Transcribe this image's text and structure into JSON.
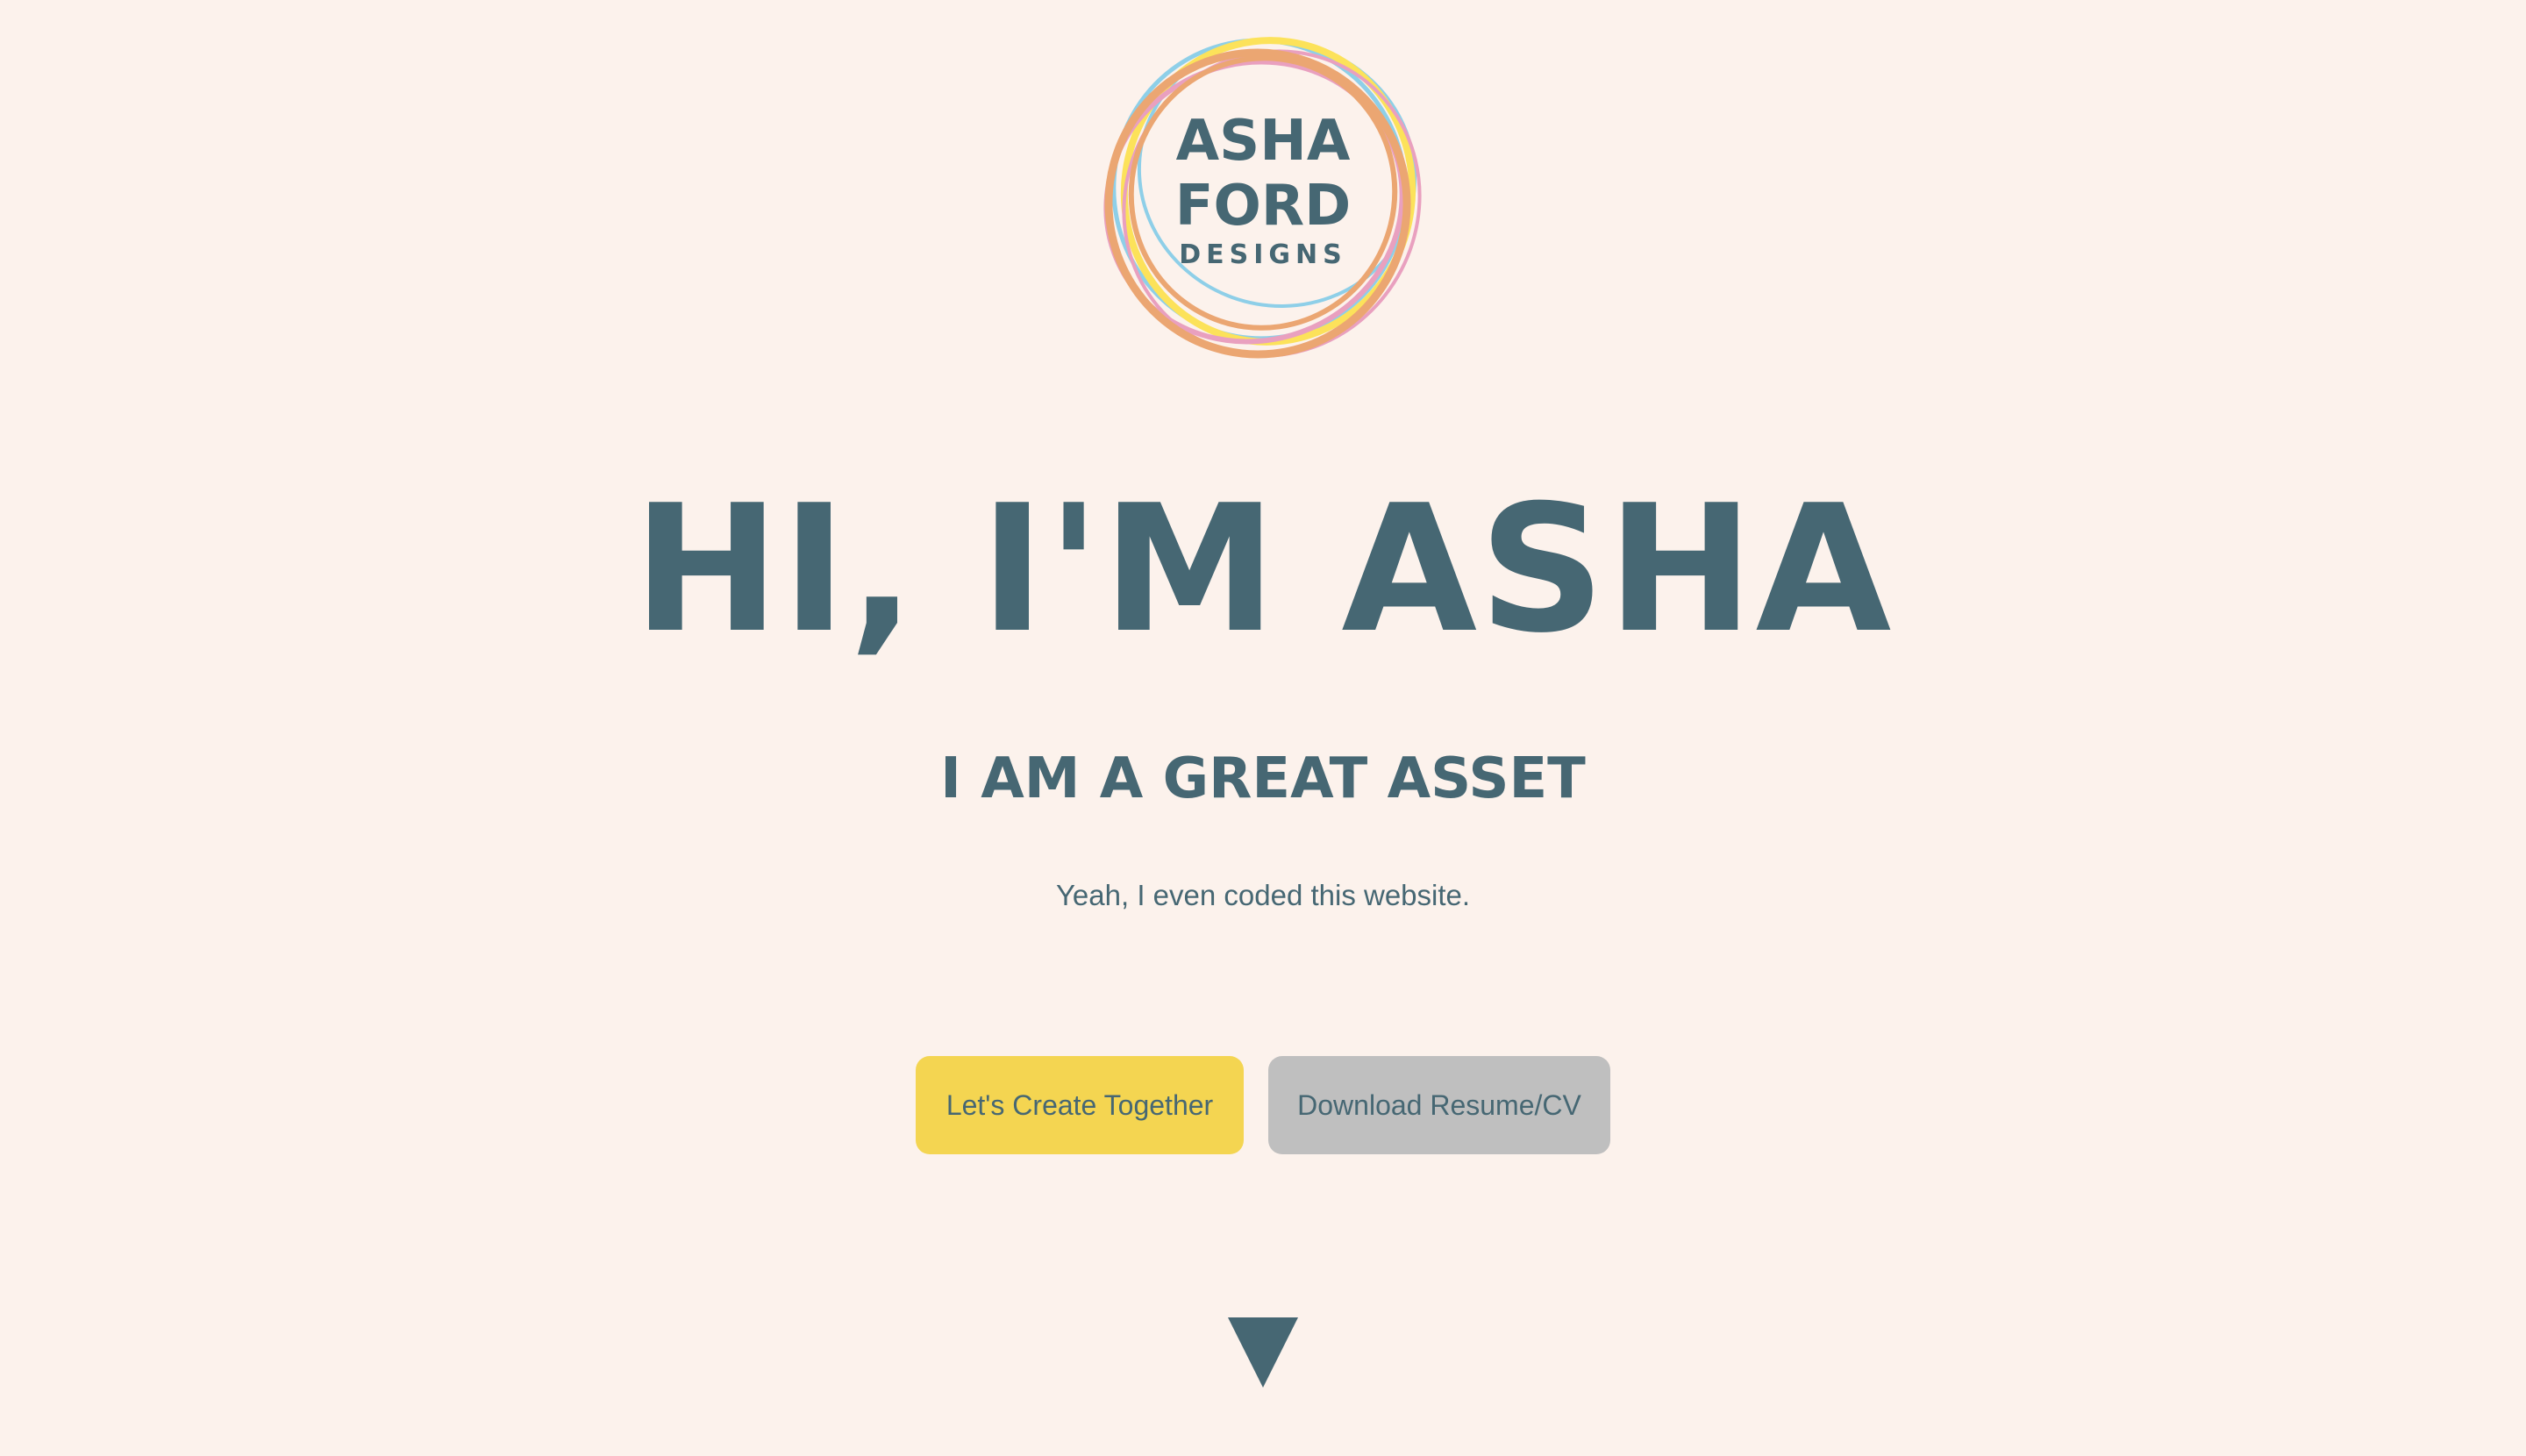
{
  "colors": {
    "background": "#fcf2ec",
    "primary_text": "#466773",
    "button_primary": "#f4d551",
    "button_secondary": "#bfbfbf",
    "logo_rings": [
      "#8ecfe8",
      "#fce25a",
      "#e9a0bf",
      "#eba672"
    ]
  },
  "logo": {
    "line1": "ASHA",
    "line2": "FORD",
    "line3": "DESIGNS"
  },
  "hero": {
    "title": "HI, I'M ASHA",
    "subtitle": "I AM A GREAT ASSET",
    "tagline": "Yeah, I even coded this website."
  },
  "buttons": {
    "primary_label": "Let's Create Together",
    "secondary_label": "Download Resume/CV"
  },
  "icons": {
    "scroll": "triangle-down-icon"
  }
}
